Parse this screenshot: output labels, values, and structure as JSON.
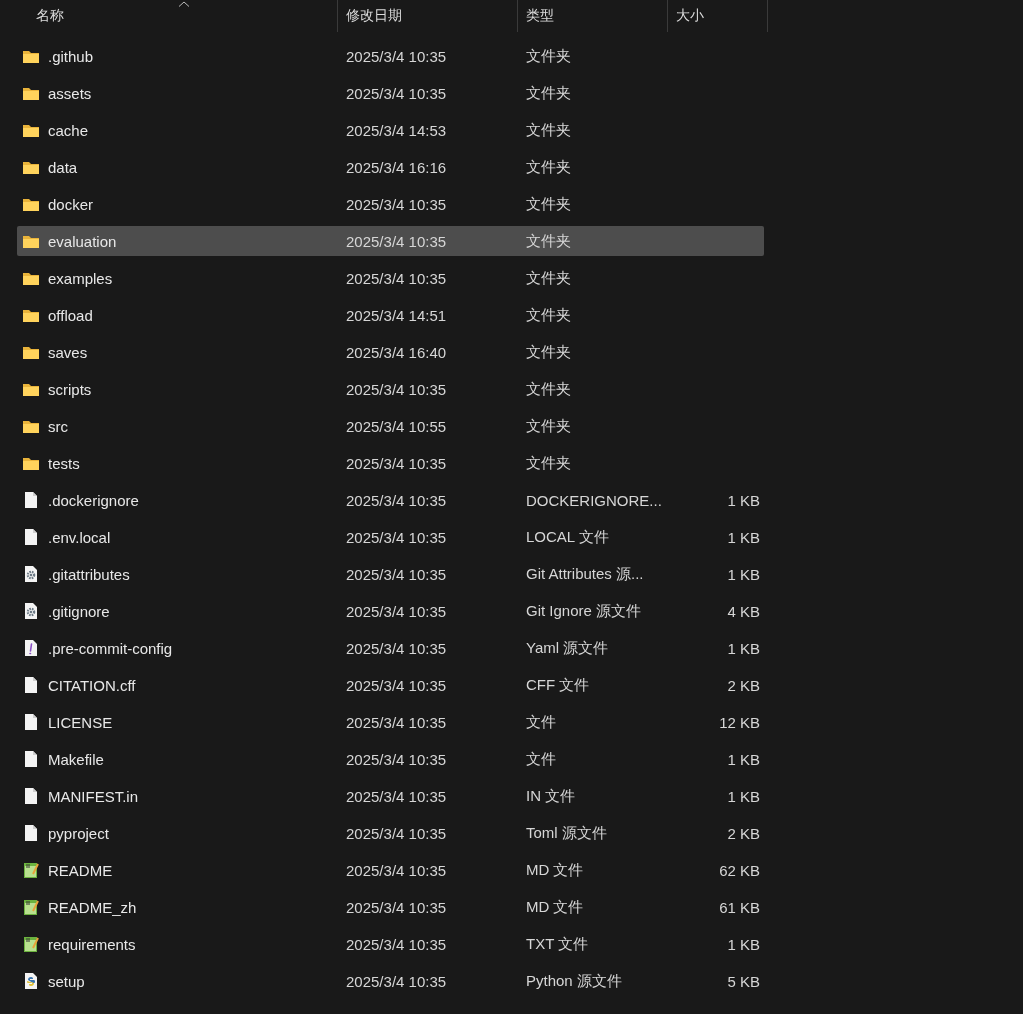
{
  "columns": [
    {
      "label": "名称",
      "sorted": true
    },
    {
      "label": "修改日期",
      "sorted": false
    },
    {
      "label": "类型",
      "sorted": false
    },
    {
      "label": "大小",
      "sorted": false
    }
  ],
  "rows": [
    {
      "kind": "folder",
      "name": ".github",
      "date": "2025/3/4 10:35",
      "type": "文件夹",
      "selected": false
    },
    {
      "kind": "folder",
      "name": "assets",
      "date": "2025/3/4 10:35",
      "type": "文件夹",
      "selected": false
    },
    {
      "kind": "folder",
      "name": "cache",
      "date": "2025/3/4 14:53",
      "type": "文件夹",
      "selected": false
    },
    {
      "kind": "folder",
      "name": "data",
      "date": "2025/3/4 16:16",
      "type": "文件夹",
      "selected": false
    },
    {
      "kind": "folder",
      "name": "docker",
      "date": "2025/3/4 10:35",
      "type": "文件夹",
      "selected": false
    },
    {
      "kind": "folder",
      "name": "evaluation",
      "date": "2025/3/4 10:35",
      "type": "文件夹",
      "selected": true
    },
    {
      "kind": "folder",
      "name": "examples",
      "date": "2025/3/4 10:35",
      "type": "文件夹",
      "selected": false
    },
    {
      "kind": "folder",
      "name": "offload",
      "date": "2025/3/4 14:51",
      "type": "文件夹",
      "selected": false
    },
    {
      "kind": "folder",
      "name": "saves",
      "date": "2025/3/4 16:40",
      "type": "文件夹",
      "selected": false
    },
    {
      "kind": "folder",
      "name": "scripts",
      "date": "2025/3/4 10:35",
      "type": "文件夹",
      "selected": false
    },
    {
      "kind": "folder",
      "name": "src",
      "date": "2025/3/4 10:55",
      "type": "文件夹",
      "selected": false
    },
    {
      "kind": "folder",
      "name": "tests",
      "date": "2025/3/4 10:35",
      "type": "文件夹",
      "selected": false
    },
    {
      "kind": "file",
      "name": ".dockerignore",
      "date": "2025/3/4 10:35",
      "type": "DOCKERIGNORE...",
      "size": "1 KB",
      "selected": false
    },
    {
      "kind": "file",
      "name": ".env.local",
      "date": "2025/3/4 10:35",
      "type": "LOCAL 文件",
      "size": "1 KB",
      "selected": false
    },
    {
      "kind": "settings",
      "name": ".gitattributes",
      "date": "2025/3/4 10:35",
      "type": "Git Attributes 源...",
      "size": "1 KB",
      "selected": false
    },
    {
      "kind": "settings",
      "name": ".gitignore",
      "date": "2025/3/4 10:35",
      "type": "Git Ignore 源文件",
      "size": "4 KB",
      "selected": false
    },
    {
      "kind": "yaml",
      "name": ".pre-commit-config",
      "date": "2025/3/4 10:35",
      "type": "Yaml 源文件",
      "size": "1 KB",
      "selected": false
    },
    {
      "kind": "file",
      "name": "CITATION.cff",
      "date": "2025/3/4 10:35",
      "type": "CFF 文件",
      "size": "2 KB",
      "selected": false
    },
    {
      "kind": "file",
      "name": "LICENSE",
      "date": "2025/3/4 10:35",
      "type": "文件",
      "size": "12 KB",
      "selected": false
    },
    {
      "kind": "file",
      "name": "Makefile",
      "date": "2025/3/4 10:35",
      "type": "文件",
      "size": "1 KB",
      "selected": false
    },
    {
      "kind": "file",
      "name": "MANIFEST.in",
      "date": "2025/3/4 10:35",
      "type": "IN 文件",
      "size": "1 KB",
      "selected": false
    },
    {
      "kind": "file",
      "name": "pyproject",
      "date": "2025/3/4 10:35",
      "type": "Toml 源文件",
      "size": "2 KB",
      "selected": false
    },
    {
      "kind": "text",
      "name": "README",
      "date": "2025/3/4 10:35",
      "type": "MD 文件",
      "size": "62 KB",
      "selected": false
    },
    {
      "kind": "text",
      "name": "README_zh",
      "date": "2025/3/4 10:35",
      "type": "MD 文件",
      "size": "61 KB",
      "selected": false
    },
    {
      "kind": "text",
      "name": "requirements",
      "date": "2025/3/4 10:35",
      "type": "TXT 文件",
      "size": "1 KB",
      "selected": false
    },
    {
      "kind": "python",
      "name": "setup",
      "date": "2025/3/4 10:35",
      "type": "Python 源文件",
      "size": "5 KB",
      "selected": false
    }
  ]
}
